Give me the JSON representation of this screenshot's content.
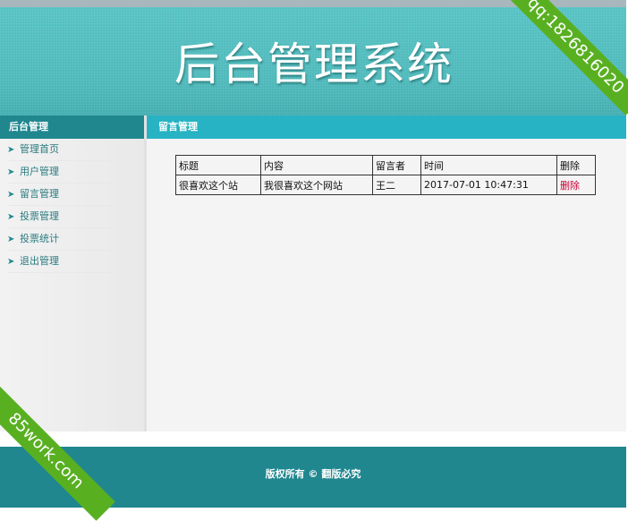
{
  "header": {
    "title": "后台管理系统"
  },
  "sidebar": {
    "heading": "后台管理",
    "items": [
      {
        "label": "管理首页"
      },
      {
        "label": "用户管理"
      },
      {
        "label": "留言管理"
      },
      {
        "label": "投票管理"
      },
      {
        "label": "投票统计"
      },
      {
        "label": "退出管理"
      }
    ]
  },
  "main": {
    "heading": "留言管理",
    "table": {
      "columns": [
        "标题",
        "内容",
        "留言者",
        "时间",
        "删除"
      ],
      "rows": [
        {
          "title": "很喜欢这个站",
          "content": "我很喜欢这个网站",
          "author": "王二",
          "time": "2017-07-01 10:47:31",
          "delete": "删除"
        }
      ]
    }
  },
  "footer": {
    "copyright": "版权所有 © 翻版必究"
  },
  "watermarks": {
    "top_right": "qq:1826816020",
    "bottom_left": "85work.com"
  },
  "colors": {
    "header_bg": "#4fb9bb",
    "teal_dark": "#20878f",
    "teal_bright": "#27b3c3",
    "delete_red": "#cc0033",
    "ribbon_green": "#58b021"
  }
}
